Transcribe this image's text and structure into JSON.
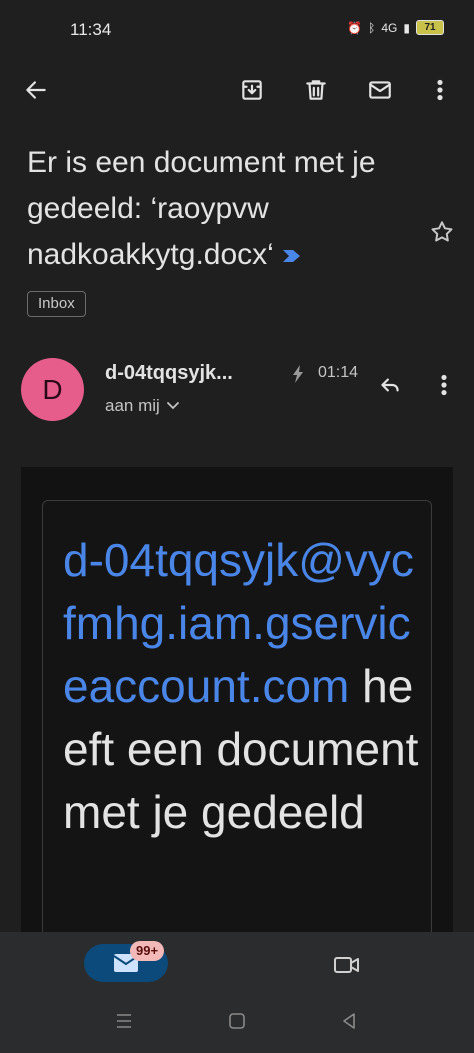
{
  "status_bar": {
    "time": "11:34",
    "network": "4G",
    "battery": "71"
  },
  "app_bar": {
    "back": "back-arrow-icon",
    "archive": "archive-icon",
    "delete": "trash-icon",
    "mark_unread": "mail-icon",
    "more": "more-vertical-icon"
  },
  "email": {
    "subject": "Er is een document met je gedeeld: ‘raoypvw nadkoakkytg.docx‘",
    "label": "Inbox",
    "sender_initial": "D",
    "sender": "d-04tqqsyjk...",
    "time": "01:14",
    "recipient": "aan mij",
    "body_link": "d-04tqqsyjk@vycfmhg.iam.gserviceaccount.com",
    "body_text": " heeft een document met je gedeeld"
  },
  "bottom_nav": {
    "mail_badge": "99+"
  },
  "colors": {
    "accent": "#4a86e8",
    "avatar": "#e65d8c",
    "badge": "#f3b8b8"
  }
}
